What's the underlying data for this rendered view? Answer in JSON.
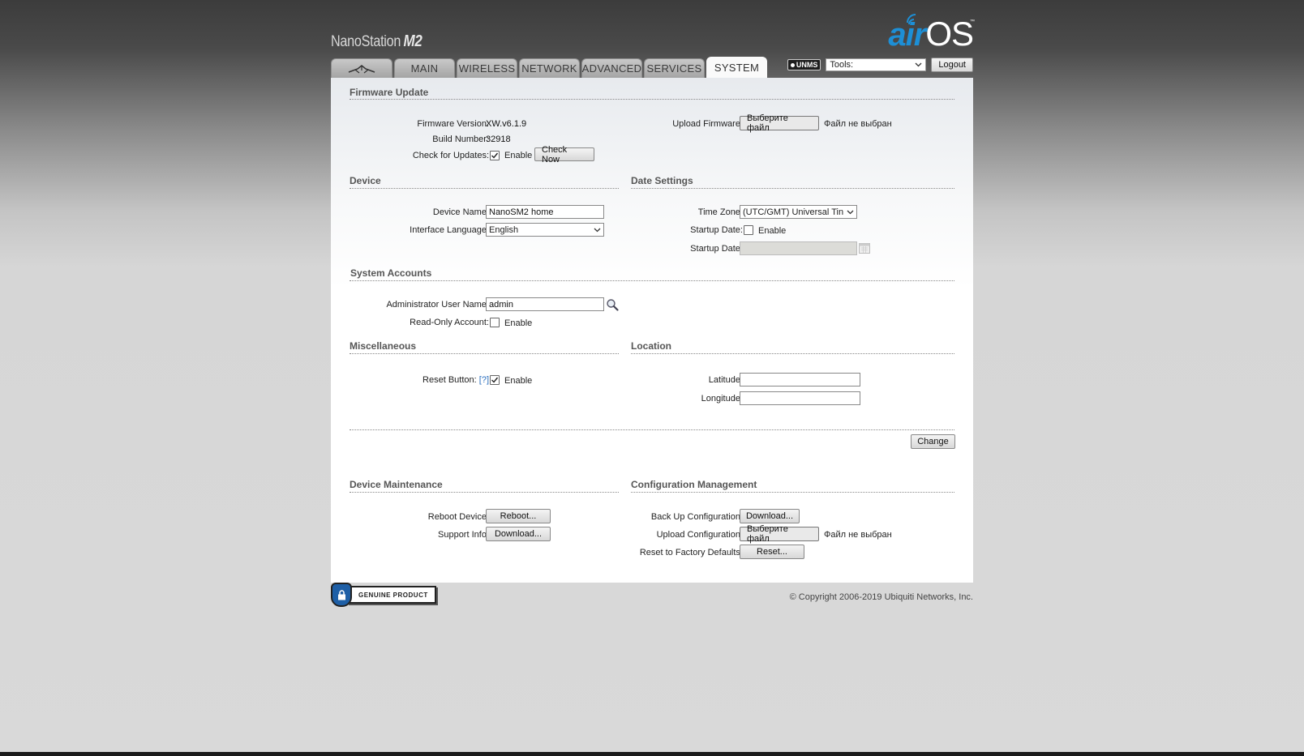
{
  "header": {
    "model_name": "NanoStation",
    "model_suffix": "M2",
    "logo_air": "air",
    "logo_os": "OS",
    "logo_tm": "™"
  },
  "tabs": [
    {
      "label": "",
      "icon": "ubiquiti-logo-icon",
      "active": false
    },
    {
      "label": "MAIN",
      "active": false
    },
    {
      "label": "WIRELESS",
      "active": false
    },
    {
      "label": "NETWORK",
      "active": false
    },
    {
      "label": "ADVANCED",
      "active": false
    },
    {
      "label": "SERVICES",
      "active": false
    },
    {
      "label": "SYSTEM",
      "active": true
    }
  ],
  "topbar": {
    "unms_label": "UNMS",
    "tools_selected": "Tools:",
    "logout_label": "Logout"
  },
  "firmware": {
    "title": "Firmware Update",
    "version_label": "Firmware Version:",
    "version_value": "XW.v6.1.9",
    "build_label": "Build Number:",
    "build_value": "32918",
    "check_label": "Check for Updates:",
    "check_enabled": true,
    "enable_text": "Enable",
    "check_now_label": "Check Now",
    "upload_label": "Upload Firmware:",
    "choose_file_label": "Выберите файл",
    "no_file_text": "Файл не выбран"
  },
  "device": {
    "title": "Device",
    "name_label": "Device Name:",
    "name_value": "NanoSM2 home",
    "language_label": "Interface Language:",
    "language_value": "English"
  },
  "date_settings": {
    "title": "Date Settings",
    "timezone_label": "Time Zone:",
    "timezone_value": "(UTC/GMT) Universal Tin",
    "startup_date_label": "Startup Date:",
    "startup_date_enabled": false,
    "enable_text": "Enable",
    "startup_date_value_label": "Startup Date:",
    "startup_date_value": ""
  },
  "accounts": {
    "title": "System Accounts",
    "admin_label": "Administrator User Name:",
    "admin_value": "admin",
    "readonly_label": "Read-Only Account:",
    "readonly_enabled": false,
    "enable_text": "Enable"
  },
  "misc": {
    "title": "Miscellaneous",
    "reset_label": "Reset Button:",
    "help_text": "[?]",
    "reset_enabled": true,
    "enable_text": "Enable"
  },
  "location": {
    "title": "Location",
    "latitude_label": "Latitude:",
    "latitude_value": "",
    "longitude_label": "Longitude:",
    "longitude_value": ""
  },
  "change_label": "Change",
  "maintenance": {
    "title": "Device Maintenance",
    "reboot_label": "Reboot Device:",
    "reboot_button": "Reboot...",
    "support_label": "Support Info:",
    "support_button": "Download..."
  },
  "config": {
    "title": "Configuration Management",
    "backup_label": "Back Up Configuration:",
    "backup_button": "Download...",
    "upload_label": "Upload Configuration:",
    "choose_file_label": "Выберите файл",
    "no_file_text": "Файл не выбран",
    "reset_label": "Reset to Factory Defaults:",
    "reset_button": "Reset..."
  },
  "footer": {
    "badge_text": "GENUINE PRODUCT",
    "copyright": "© Copyright 2006-2019 Ubiquiti Networks, Inc."
  }
}
